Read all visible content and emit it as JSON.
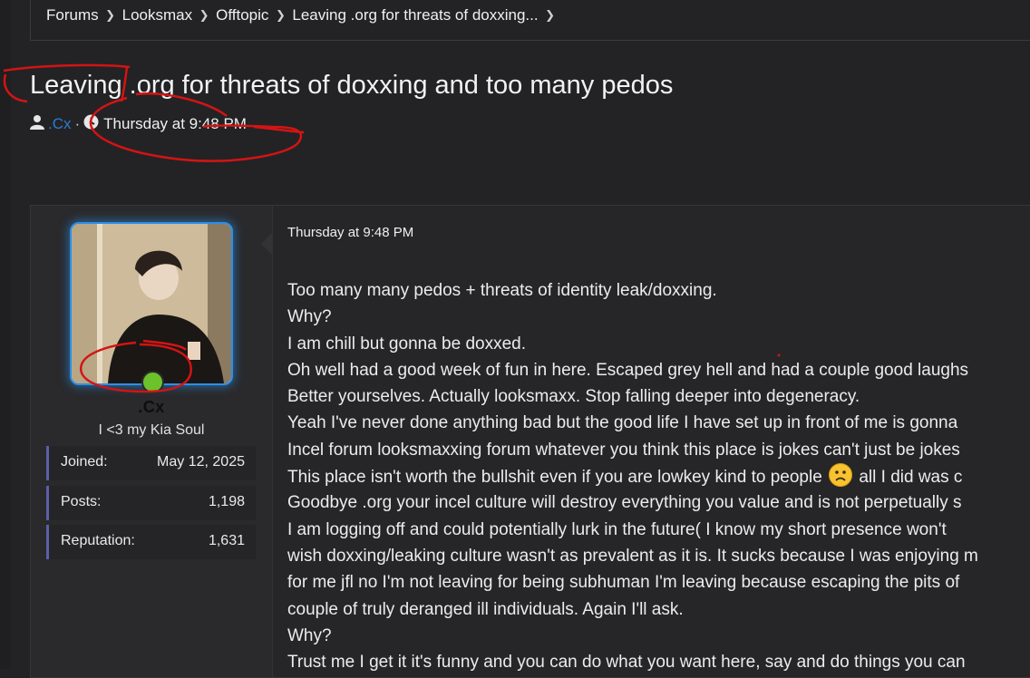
{
  "breadcrumb": {
    "items": [
      "Forums",
      "Looksmax",
      "Offtopic",
      "Leaving .org for threats of doxxing..."
    ]
  },
  "thread": {
    "title": "Leaving .org for threats of doxxing and too many pedos",
    "author": ".Cx",
    "date": "Thursday at 9:48 PM"
  },
  "post": {
    "date": "Thursday at 9:48 PM",
    "user": {
      "name": ".Cx",
      "title": "I <3 my Kia Soul",
      "stats": [
        {
          "label": "Joined:",
          "value": "May 12, 2025"
        },
        {
          "label": "Posts:",
          "value": "1,198"
        },
        {
          "label": "Reputation:",
          "value": "1,631"
        }
      ]
    },
    "lines": [
      "Too many many pedos + threats of identity leak/doxxing.",
      "Why?",
      "I am chill but gonna be doxxed.",
      "Oh well had a good week of fun in here. Escaped grey hell and had a couple good laughs",
      "Better yourselves. Actually looksmaxx. Stop falling deeper into degeneracy.",
      "Yeah I've never done anything bad but the good life I have set up in front of me is gonna",
      "Incel forum looksmaxxing forum whatever you think this place is jokes can't just be jokes",
      "This place isn't worth the bullshit even if you are lowkey kind to people",
      "Goodbye .org your incel culture will destroy everything you value and is not perpetually s",
      "I am logging off and could potentially lurk in the future( I know my short presence won't",
      "wish doxxing/leaking culture wasn't as prevalent as it is. It sucks because I was enjoying m",
      "for me jfl no I'm not leaving for being subhuman I'm leaving because escaping the pits of",
      "couple of truly deranged ill individuals. Again I'll ask.",
      "Why?",
      "Trust me I get it it's funny and you can do what you want here, say and do things you can"
    ],
    "line8_tail": "all I did was c"
  },
  "colors": {
    "background": "#232325",
    "accent_blue": "#2a90e8",
    "online_green": "#6cc22b",
    "scribble_red": "#d31414"
  }
}
